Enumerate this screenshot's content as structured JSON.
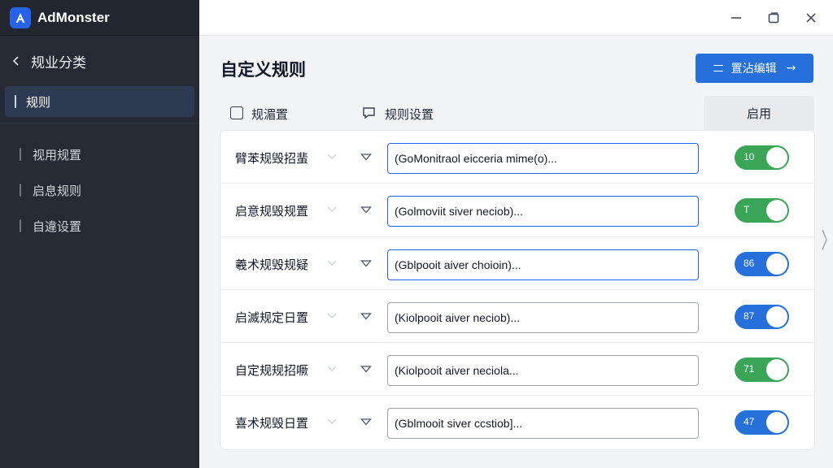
{
  "app": {
    "name": "AdMonster"
  },
  "sidebar": {
    "section": "规业分类",
    "active_item": "规则",
    "items": [
      {
        "label": "视用规置"
      },
      {
        "label": "启息规则"
      },
      {
        "label": "自違设置"
      }
    ]
  },
  "main": {
    "title": "自定义规则",
    "primary_button": "置沾编辑",
    "header": {
      "col1": "规湄置",
      "col2": "规则设置",
      "col3": "启用"
    },
    "rows": [
      {
        "label": "臂苯规毁招蜚",
        "value": "(GoMonitraol eicceria mime(o)...",
        "toggle_text": "10",
        "toggle_color": "#3aa457",
        "active": true
      },
      {
        "label": "启意规毁规置",
        "value": "(Golmoviit siver neciob)...",
        "toggle_text": "T",
        "toggle_color": "#3aa457",
        "active": true
      },
      {
        "label": "羲术规毁规疑",
        "value": "(Gblpooit aiver choioin)...",
        "toggle_text": "86",
        "toggle_color": "#2670db",
        "active": true
      },
      {
        "label": "启滅规定日置",
        "value": "(Kiolpooit aiver neciob)...",
        "toggle_text": "87",
        "toggle_color": "#2670db",
        "active": false
      },
      {
        "label": "自定规规招噘",
        "value": "(Kiolpooit aiver neciola...",
        "toggle_text": "71",
        "toggle_color": "#3aa457",
        "active": false
      },
      {
        "label": "喜术规毁日置",
        "value": "(Gblmooit siver ccstiob]...",
        "toggle_text": "47",
        "toggle_color": "#2670db",
        "active": false
      }
    ]
  }
}
